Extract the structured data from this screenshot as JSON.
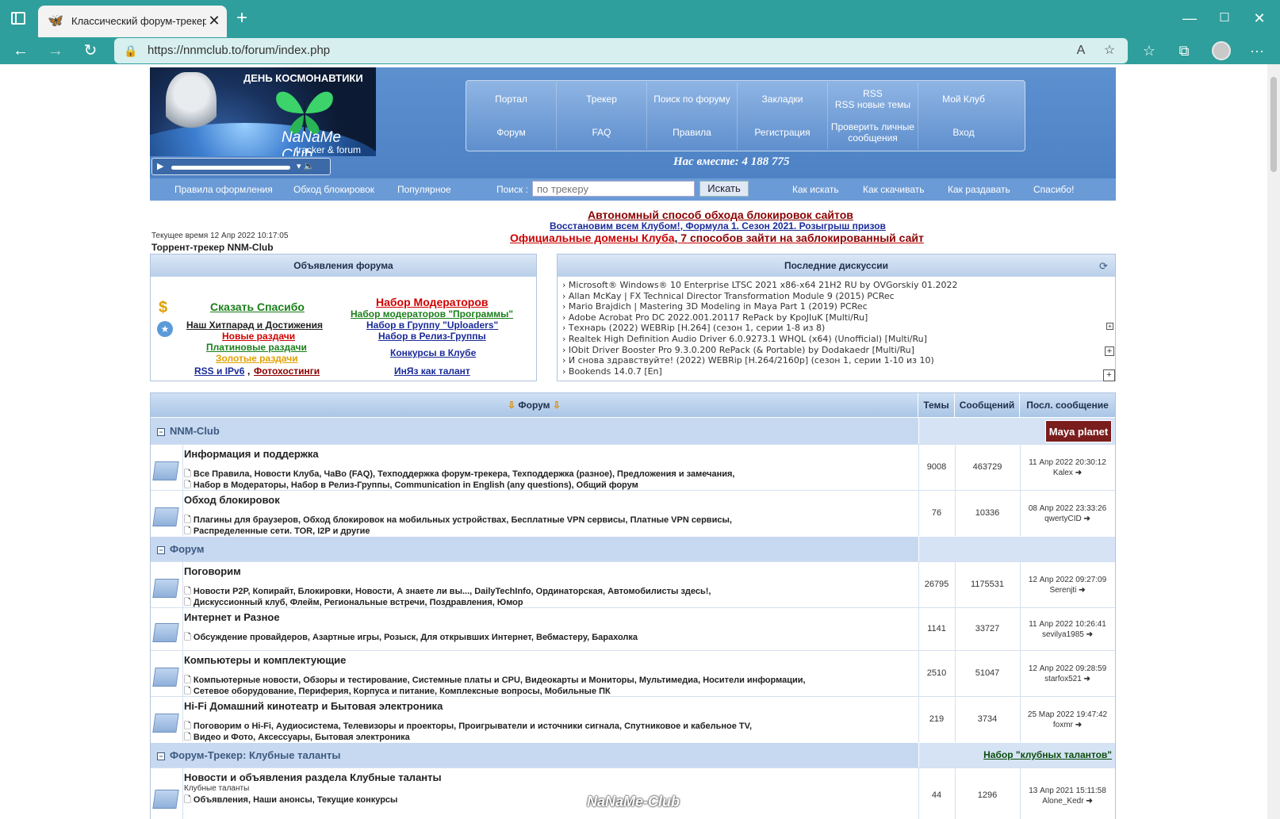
{
  "browser": {
    "tab_title": "Классический форум-трекер :: ",
    "url": "https://nnmclub.to/forum/index.php"
  },
  "header": {
    "logo_title": "ДЕНЬ КОСМОНАВТИКИ",
    "logo_name": "NaNaMe Club",
    "logo_sub": "tracker & forum",
    "nav_row1": [
      "Портал",
      "Трекер",
      "Поиск по форуму",
      "Закладки",
      "RSS\nRSS новые темы",
      "Мой Клуб"
    ],
    "nav_row2": [
      "Форум",
      "FAQ",
      "Правила",
      "Регистрация",
      "Проверить личные сообщения",
      "Вход"
    ],
    "together": "Нас вместе: 4 188 775",
    "subnav_left": [
      "Правила оформления",
      "Обход блокировок",
      "Популярное"
    ],
    "search_label": "Поиск :",
    "search_placeholder": "по трекеру",
    "search_button": "Искать",
    "subnav_right": [
      "Как искать",
      "Как скачивать",
      "Как раздавать",
      "Спасибо!"
    ]
  },
  "notices": {
    "time": "Текущее время 12 Апр 2022 10:17:05",
    "tracker_title": "Торрент-трекер NNM-Club",
    "line1": "Автономный способ обхода блокировок сайтов",
    "line2a": "Восстановим всем Клубом!",
    "line2b": "Формула 1. Сезон 2021. Розыгрыш призов",
    "line3a": "Официальные домены Клуба",
    "line3b": "7 способов зайти на заблокированный сайт"
  },
  "announcements": {
    "title": "Объявления форума",
    "left_links": [
      {
        "text": "Сказать Спасибо",
        "color": "#1a7f1a"
      },
      {
        "text": "Наш Хитпарад и Достижения",
        "color": "#222222"
      },
      {
        "text": "Новые раздачи",
        "color": "#d00000"
      },
      {
        "text": "Платиновые раздачи",
        "color": "#1a7f1a"
      },
      {
        "text": "Золотые раздачи",
        "color": "#e0a000"
      },
      {
        "text": "RSS и IPv6",
        "color": "#1a2b9a"
      },
      {
        "text": "Фотохостинги",
        "color": "#8b0000"
      }
    ],
    "right_links": [
      {
        "text": "Набор Модераторов",
        "color": "#d00000"
      },
      {
        "text": "Набор модераторов \"Программы\"",
        "color": "#1a7f1a"
      },
      {
        "text": "Набор в Группу \"Uploaders\"",
        "color": "#1a2b9a"
      },
      {
        "text": "Набор в Релиз-Группы",
        "color": "#1a2b9a"
      },
      {
        "text": "Конкурсы в Клубе",
        "color": "#1a2b9a"
      },
      {
        "text": "ИнЯз как талант",
        "color": "#1a2b9a"
      }
    ]
  },
  "discussions": {
    "title": "Последние дискуссии",
    "items": [
      "› Microsoft® Windows® 10 Enterprise LTSC 2021 x86-x64 21H2 RU by OVGorskiy 01.2022",
      "› Allan McKay | FX Technical Director Transformation Module 9 (2015) PCRec",
      "› Mario Brajdich | Mastering 3D Modeling in Maya Part 1 (2019) PCRec",
      "› Adobe Acrobat Pro DC 2022.001.20117 RePack by KpoJIuK [Multi/Ru]",
      "› Технарь (2022) WEBRip [H.264] (сезон 1, серии 1-8 из 8)",
      "› Realtek High Definition Audio Driver 6.0.9273.1 WHQL (x64) (Unofficial) [Multi/Ru]",
      "› IObit Driver Booster Pro 9.3.0.200 RePack (& Portable) by Dodakaedr [Multi/Ru]",
      "› И снова здравствуйте! (2022) WEBRip [H.264/2160p] (сезон 1, серии 1-10 из 10)",
      "› Bookends 14.0.7 [En]"
    ]
  },
  "forum": {
    "headers": [
      "Форум",
      "Темы",
      "Сообщений",
      "Посл. сообщение"
    ],
    "categories": [
      {
        "title": "NNM-Club",
        "right": "Maya planet"
      },
      {
        "title": "Форум",
        "right": ""
      },
      {
        "title": "Форум-Трекер: Клубные таланты",
        "right": "Набор \"клубных талантов\""
      }
    ],
    "rows": [
      {
        "title": "Информация и поддержка",
        "subs1": "Все Правила,  Новости Клуба,  ЧаВо (FAQ),  Техподдержка форум-трекера,  Техподдержка (разное),  Предложения и замечания,",
        "subs2": "Набор в Модераторы,  Набор в Релиз-Группы,  Communication in English (any questions),  Общий форум",
        "topics": "9008",
        "posts": "463729",
        "last_date": "11 Апр 2022 20:30:12",
        "last_user": "Kalex"
      },
      {
        "title": "Обход блокировок",
        "subs1": "Плагины для браузеров,  Обход блокировок на мобильных устройствах,  Бесплатные VPN сервисы,  Платные VPN сервисы,",
        "subs2": "Распределенные сети. TOR, I2P и другие",
        "topics": "76",
        "posts": "10336",
        "last_date": "08 Апр 2022 23:33:26",
        "last_user": "qwertyCID"
      },
      {
        "title": "Поговорим",
        "subs1": "Новости P2P, Копирайт, Блокировки,  Новости,  А знаете ли вы...,  DailyTechInfo,  Ординаторская,  Автомобилисты здесь!,",
        "subs2": "Дискуссионный клуб,  Флейм,  Региональные встречи,  Поздравления,  Юмор",
        "topics": "26795",
        "posts": "1175531",
        "last_date": "12 Апр 2022 09:27:09",
        "last_user": "Serenjti"
      },
      {
        "title": "Интернет и Разное",
        "subs1": "Обсуждение провайдеров,  Азартные игры,  Розыск,  Для открывших Интернет,  Вебмастеру,  Барахолка",
        "subs2": "",
        "topics": "1141",
        "posts": "33727",
        "last_date": "11 Апр 2022 10:26:41",
        "last_user": "sevilya1985"
      },
      {
        "title": "Компьютеры и комплектующие",
        "subs1": "Компьютерные новости,  Обзоры и тестирование,  Системные платы и CPU,  Видеокарты и Мониторы,  Мультимедиа,  Носители информации,",
        "subs2": "Сетевое оборудование,  Периферия,  Корпуса и питание,  Комплексные вопросы,  Мобильные ПК",
        "topics": "2510",
        "posts": "51047",
        "last_date": "12 Апр 2022 09:28:59",
        "last_user": "starfox521"
      },
      {
        "title": "Hi-Fi Домашний кинотеатр и Бытовая электроника",
        "subs1": "Поговорим о Hi-Fi,  Аудиосистема,  Телевизоры и проекторы,  Проигрыватели и источники сигнала,  Спутниковое и кабельное TV,",
        "subs2": "Видео и Фото,  Аксессуары,  Бытовая электроника",
        "topics": "219",
        "posts": "3734",
        "last_date": "25 Мар 2022 19:47:42",
        "last_user": "foxmr"
      },
      {
        "title": "Новости и объявления раздела Клубные таланты",
        "small": "Клубные таланты",
        "subs1": "Объявления,  Наши анонсы,  Текущие конкурсы",
        "subs2": "",
        "topics": "44",
        "posts": "1296",
        "last_date": "13 Апр 2021 15:11:58",
        "last_user": "Alone_Kedr"
      }
    ]
  },
  "watermark": "NaNaMe-Club",
  "colors": {
    "chrome": "#2e9f9c",
    "header_blue": "#5d90cf",
    "link_blue": "#1a2b9a"
  }
}
